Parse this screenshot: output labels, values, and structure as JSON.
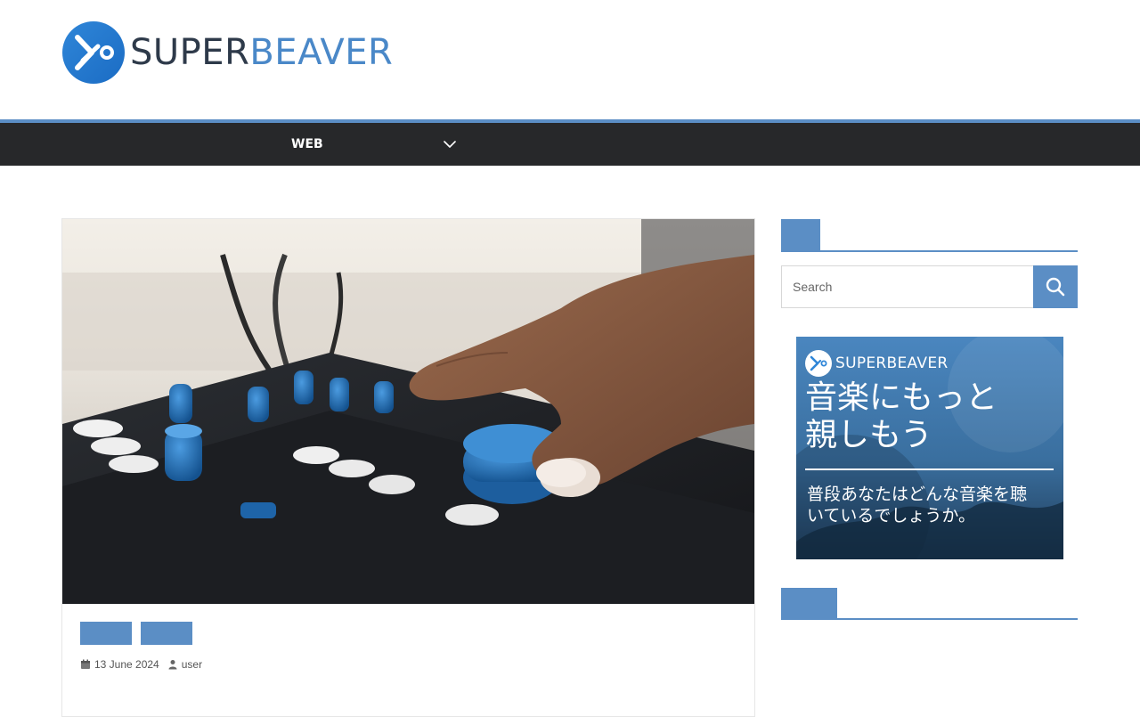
{
  "brand": {
    "name_part1": "SUPER",
    "name_part2": "BEAVER",
    "logo_icon": "superbeaver-logo-icon"
  },
  "nav": {
    "items": [
      {
        "label": "WEB"
      }
    ],
    "submenu_icon": "chevron-down-icon"
  },
  "article": {
    "image_alt": "Hand adjusting knobs on an audio mixing console",
    "categories": [
      {
        "label": ""
      },
      {
        "label": ""
      }
    ],
    "date": "13 June 2024",
    "author": "user",
    "date_icon": "calendar-icon",
    "author_icon": "user-icon"
  },
  "sidebar": {
    "search": {
      "placeholder": "Search",
      "button_icon": "search-icon"
    },
    "ad": {
      "brand": "SUPERBEAVER",
      "title_line1": "音楽にもっと",
      "title_line2": "親しもう",
      "subtitle_line1": "普段あなたはどんな音楽を聴",
      "subtitle_line2": "いているでしょうか。"
    }
  },
  "colors": {
    "accent": "#5b8ec5",
    "nav_bg": "#27282a",
    "brand_dark": "#2e3a4a",
    "brand_blue": "#4a88c8"
  }
}
